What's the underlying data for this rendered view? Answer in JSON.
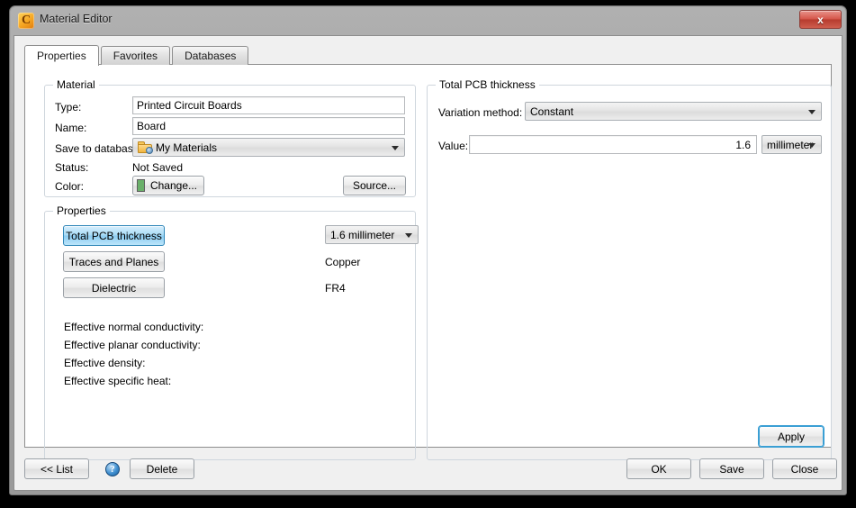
{
  "window": {
    "title": "Material Editor",
    "app_icon": "material-editor-icon",
    "app_icon_glyph": "C",
    "close_label": "x",
    "accent_blue": "#3a9fd4",
    "titlebar_color": "#a0a0a0",
    "close_button_color": "#cf5e4e"
  },
  "tabs": [
    {
      "label": "Properties",
      "active": true
    },
    {
      "label": "Favorites",
      "active": false
    },
    {
      "label": "Databases",
      "active": false
    }
  ],
  "material_group": {
    "title": "Material",
    "type_label": "Type:",
    "type_value": "Printed Circuit Boards",
    "name_label": "Name:",
    "name_value": "Board",
    "save_to_database_label": "Save to database:",
    "save_to_database_value": "My Materials",
    "status_label": "Status:",
    "status_value": "Not Saved",
    "color_label": "Color:",
    "color_change_label": "Change...",
    "color_swatch_hex": "#6ab06a",
    "source_label": "Source..."
  },
  "properties_group": {
    "title": "Properties",
    "rows": [
      {
        "button": "Total PCB thickness",
        "selected": true,
        "value": "1.6 millimeter",
        "value_is_combo": true
      },
      {
        "button": "Traces and Planes",
        "selected": false,
        "value": "Copper",
        "value_is_combo": false
      },
      {
        "button": "Dielectric",
        "selected": false,
        "value": "FR4",
        "value_is_combo": false
      }
    ],
    "effective": [
      {
        "label": "Effective normal conductivity:",
        "value": ""
      },
      {
        "label": "Effective planar conductivity:",
        "value": ""
      },
      {
        "label": "Effective density:",
        "value": ""
      },
      {
        "label": "Effective specific heat:",
        "value": ""
      }
    ]
  },
  "thickness_group": {
    "title": "Total PCB thickness",
    "variation_method_label": "Variation method:",
    "variation_method_value": "Constant",
    "value_label": "Value:",
    "value_value": "1.6",
    "unit_value": "millimeter",
    "apply_label": "Apply"
  },
  "footer": {
    "list_label": "<< List",
    "help_label": "?",
    "delete_label": "Delete",
    "ok_label": "OK",
    "save_label": "Save",
    "close_label": "Close"
  }
}
